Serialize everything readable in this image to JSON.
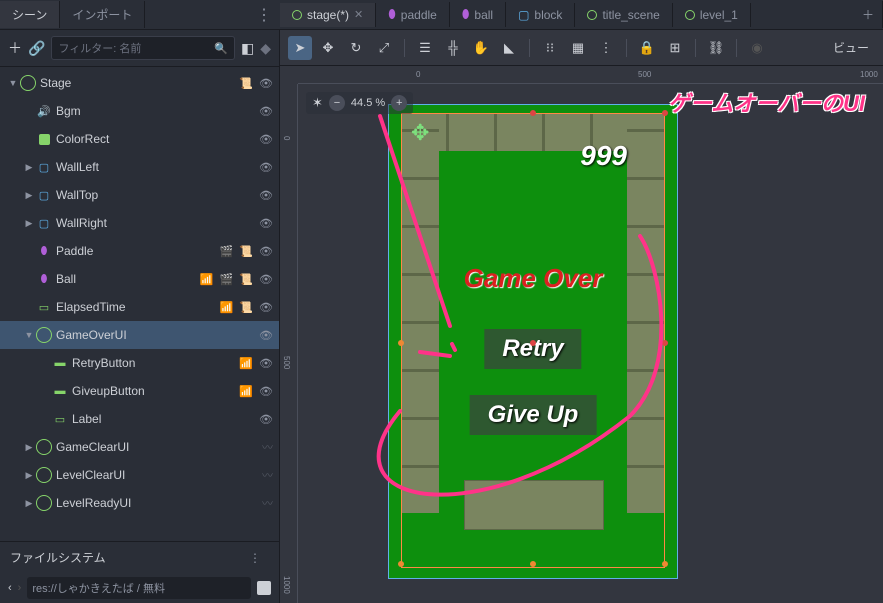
{
  "panel_tabs": {
    "scene": "シーン",
    "import": "インポート"
  },
  "doc_tabs": [
    {
      "name": "stage(*)",
      "active": true,
      "closeable": true,
      "icon": "control"
    },
    {
      "name": "paddle",
      "icon": "char"
    },
    {
      "name": "ball",
      "icon": "char"
    },
    {
      "name": "block",
      "icon": "body"
    },
    {
      "name": "title_scene",
      "icon": "control"
    },
    {
      "name": "level_1",
      "icon": "control"
    }
  ],
  "filter_placeholder": "フィルター: 名前",
  "tree": [
    {
      "d": 0,
      "label": "Stage",
      "icon": "control",
      "exp": true,
      "acts": [
        "script",
        "eye"
      ]
    },
    {
      "d": 1,
      "label": "Bgm",
      "icon": "audio",
      "acts": [
        "eye"
      ]
    },
    {
      "d": 1,
      "label": "ColorRect",
      "icon": "color",
      "acts": [
        "eye"
      ]
    },
    {
      "d": 1,
      "label": "WallLeft",
      "icon": "body",
      "arrow": true,
      "acts": [
        "eye"
      ]
    },
    {
      "d": 1,
      "label": "WallTop",
      "icon": "body",
      "arrow": true,
      "acts": [
        "eye"
      ]
    },
    {
      "d": 1,
      "label": "WallRight",
      "icon": "body",
      "arrow": true,
      "acts": [
        "eye"
      ]
    },
    {
      "d": 1,
      "label": "Paddle",
      "icon": "char",
      "acts": [
        "clap",
        "script",
        "eye"
      ]
    },
    {
      "d": 1,
      "label": "Ball",
      "icon": "char",
      "acts": [
        "sig",
        "clap",
        "script",
        "eye"
      ]
    },
    {
      "d": 1,
      "label": "ElapsedTime",
      "icon": "label",
      "acts": [
        "sig",
        "script",
        "eye"
      ]
    },
    {
      "d": 1,
      "label": "GameOverUI",
      "icon": "control",
      "exp": true,
      "sel": true,
      "acts": [
        "eye"
      ]
    },
    {
      "d": 2,
      "label": "RetryButton",
      "icon": "btn",
      "acts": [
        "sig",
        "eye"
      ]
    },
    {
      "d": 2,
      "label": "GiveupButton",
      "icon": "btn",
      "acts": [
        "sig",
        "eye"
      ]
    },
    {
      "d": 2,
      "label": "Label",
      "icon": "label",
      "acts": [
        "eye"
      ]
    },
    {
      "d": 1,
      "label": "GameClearUI",
      "icon": "control",
      "arrow": true,
      "acts": [
        "hidden"
      ]
    },
    {
      "d": 1,
      "label": "LevelClearUI",
      "icon": "control",
      "arrow": true,
      "acts": [
        "hidden"
      ]
    },
    {
      "d": 1,
      "label": "LevelReadyUI",
      "icon": "control",
      "arrow": true,
      "acts": [
        "hidden"
      ]
    }
  ],
  "filesystem_header": "ファイルシステム",
  "fs_path": "res://しゃかきえたば / 無料",
  "view_button": "ビュー",
  "zoom_level": "44.5 %",
  "annotation": "ゲームオーバーのUI",
  "game": {
    "score": "999",
    "gameover": "Game Over",
    "retry": "Retry",
    "giveup": "Give Up"
  },
  "ruler_h_marks": [
    {
      "v": "0",
      "p": 118
    },
    {
      "v": "500",
      "p": 340
    },
    {
      "v": "1000",
      "p": 562
    }
  ],
  "ruler_v_marks": [
    {
      "v": "0",
      "p": 52
    },
    {
      "v": "500",
      "p": 272
    },
    {
      "v": "1000",
      "p": 492
    }
  ]
}
